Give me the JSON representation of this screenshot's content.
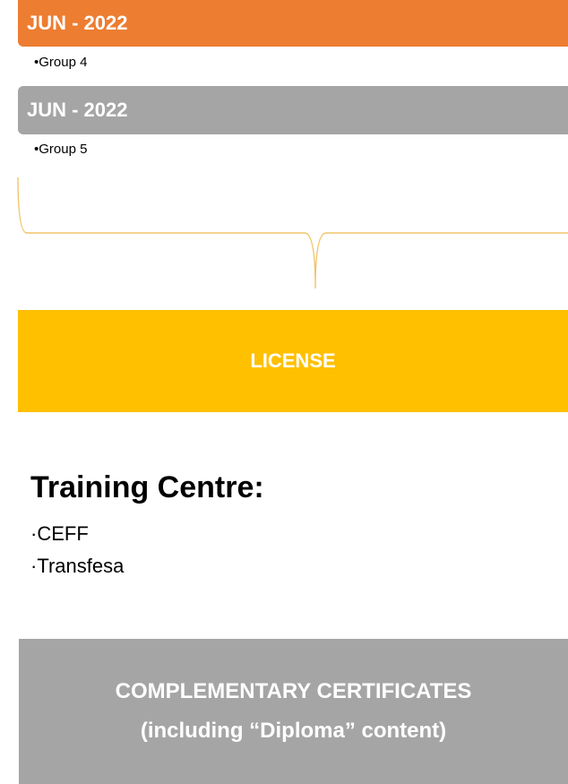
{
  "timeline": [
    {
      "date": "JUN - 2022",
      "item": "•Group 4",
      "color": "#ED7D31"
    },
    {
      "date": "JUN - 2022",
      "item": "•Group 5",
      "color": "#A5A5A5"
    }
  ],
  "license": {
    "label": "LICENSE",
    "color": "#FFC000"
  },
  "training_centre": {
    "title": "Training Centre:",
    "items": [
      "·CEFF",
      "·Transfesa"
    ]
  },
  "certificates": {
    "line1": "COMPLEMENTARY CERTIFICATES",
    "line2": "(including “Diploma” content)",
    "color": "#A5A5A5"
  },
  "brace_color": "#F2C46B"
}
